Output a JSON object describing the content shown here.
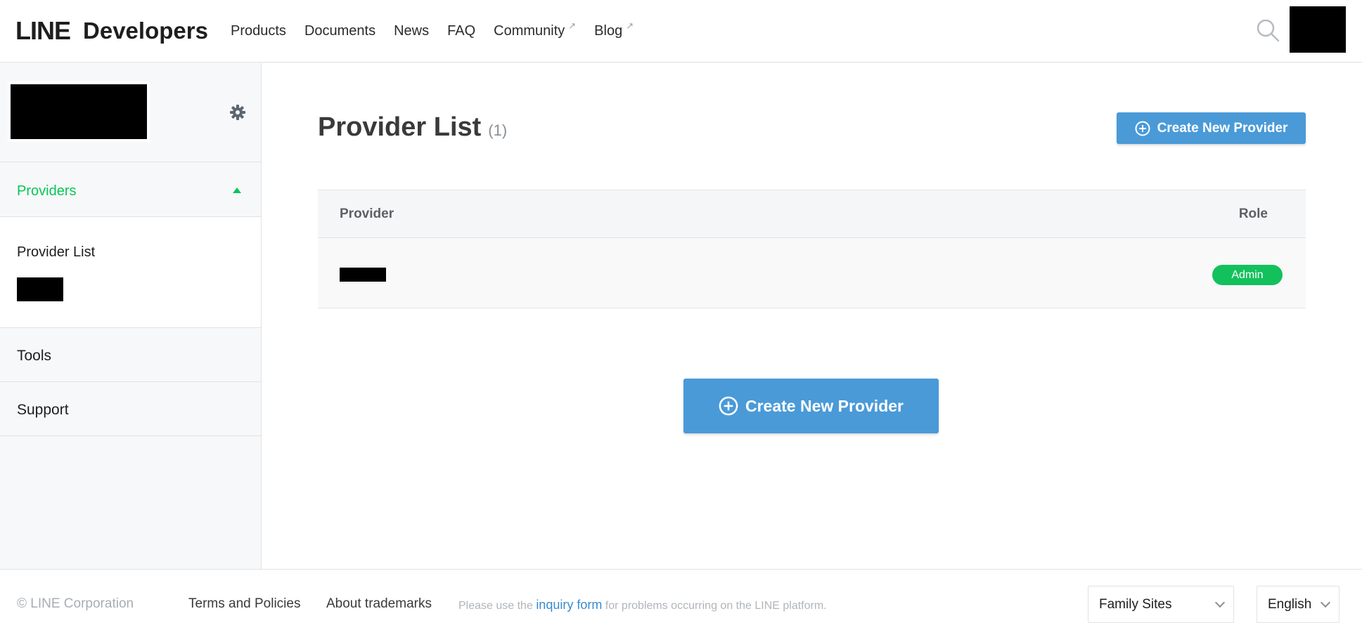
{
  "header": {
    "logo_line": "LINE",
    "logo_developers": "Developers",
    "nav": [
      {
        "label": "Products",
        "external": false
      },
      {
        "label": "Documents",
        "external": false
      },
      {
        "label": "News",
        "external": false
      },
      {
        "label": "FAQ",
        "external": false
      },
      {
        "label": "Community",
        "external": true
      },
      {
        "label": "Blog",
        "external": true
      }
    ],
    "external_glyph": "↗"
  },
  "sidebar": {
    "providers_title": "Providers",
    "submenu_item": "Provider List",
    "tools_label": "Tools",
    "support_label": "Support"
  },
  "main": {
    "title": "Provider List",
    "count": "(1)",
    "create_button_label": "Create New Provider",
    "table": {
      "col_provider": "Provider",
      "col_role": "Role",
      "rows": [
        {
          "role": "Admin"
        }
      ]
    },
    "create_button_center_label": "Create New Provider"
  },
  "footer": {
    "copyright": "© LINE Corporation",
    "terms": "Terms and Policies",
    "trademarks": "About trademarks",
    "note_prefix": "Please use the",
    "note_link": "inquiry form",
    "note_suffix": "for problems occurring on the LINE platform.",
    "family_sites": "Family Sites",
    "language": "English"
  },
  "colors": {
    "accent_green": "#06c755",
    "button_blue": "#4a9ad8",
    "badge_green": "#13c15c",
    "link_blue": "#3b8bd0"
  },
  "icons": {
    "search": "search-icon",
    "gear": "gear-icon",
    "add": "plus-circle-icon",
    "caret": "caret-up-icon",
    "external": "external-link-icon",
    "dropdown": "chevron-down-icon"
  }
}
